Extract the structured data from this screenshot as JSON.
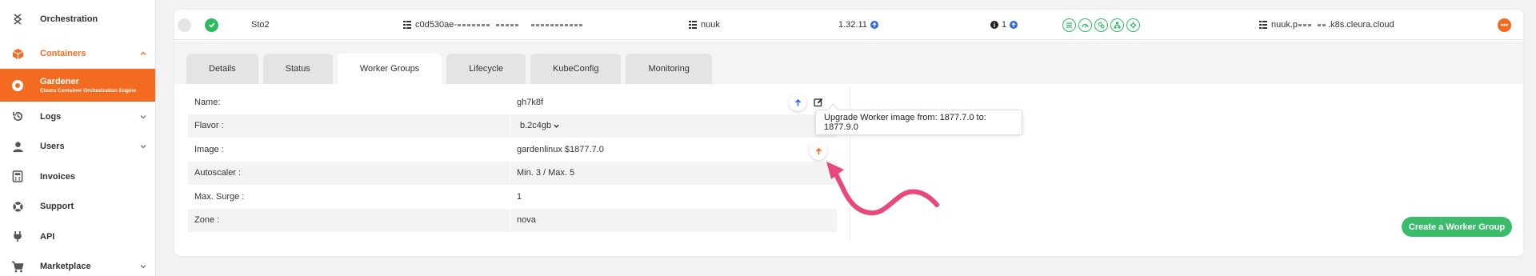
{
  "sidebar": {
    "items": [
      {
        "label": "Orchestration",
        "icon": "orchestration-icon"
      },
      {
        "label": "Containers",
        "icon": "cube-icon"
      },
      {
        "label": "Gardener",
        "sub": "Cleura Container Orchestration Engine",
        "icon": "gardener-icon"
      },
      {
        "label": "Logs",
        "icon": "history-icon"
      },
      {
        "label": "Users",
        "icon": "user-icon"
      },
      {
        "label": "Invoices",
        "icon": "calculator-icon"
      },
      {
        "label": "Support",
        "icon": "lifebuoy-icon"
      },
      {
        "label": "API",
        "icon": "plug-icon"
      },
      {
        "label": "Marketplace",
        "icon": "cart-icon"
      }
    ]
  },
  "cluster": {
    "region": "Sto2",
    "id": "c0d530ae-",
    "project": "nuuk",
    "version": "1.32.11",
    "info_count": "1",
    "domain_prefix": "nuuk.p",
    "domain_suffix": ".k8s.cleura.cloud",
    "more_label": "•••"
  },
  "tabs": [
    {
      "label": "Details"
    },
    {
      "label": "Status"
    },
    {
      "label": "Worker Groups"
    },
    {
      "label": "Lifecycle"
    },
    {
      "label": "KubeConfig"
    },
    {
      "label": "Monitoring"
    }
  ],
  "worker_group": {
    "rows": [
      {
        "label": "Name:",
        "value": "gh7k8f"
      },
      {
        "label": "Flavor :",
        "value": "b.2c4gb"
      },
      {
        "label": "Image :",
        "value": "gardenlinux $1877.7.0"
      },
      {
        "label": "Autoscaler :",
        "value": "Min. 3 / Max. 5"
      },
      {
        "label": "Max. Surge :",
        "value": "1"
      },
      {
        "label": "Zone :",
        "value": "nova"
      }
    ]
  },
  "tooltip": {
    "text": "Upgrade Worker image from: 1877.7.0 to: 1877.9.0"
  },
  "actions": {
    "create_label": "Create a Worker Group"
  },
  "colors": {
    "accent": "#f36b21",
    "success": "#2dbb5e",
    "primary": "#2f6ae0",
    "annotation": "#e8487b"
  }
}
